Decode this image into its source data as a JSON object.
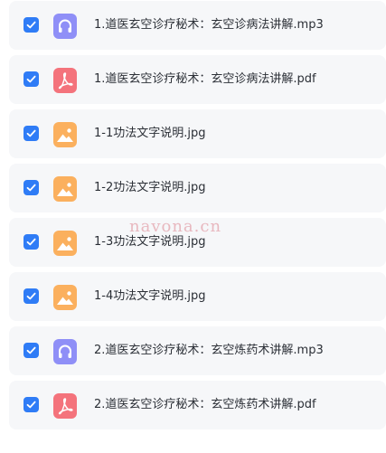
{
  "colors": {
    "checkbox": "#2f7cf6",
    "audio_icon": "#8f8ff7",
    "pdf_icon": "#f4737c",
    "image_icon": "#fbb05e",
    "row_background": "#f6f7f9",
    "watermark": "#e8b8bf"
  },
  "files": [
    {
      "name": "1.道医玄空诊疗秘术：玄空诊病法讲解.mp3",
      "icon": "headphones-icon",
      "checked": true
    },
    {
      "name": "1.道医玄空诊疗秘术：玄空诊病法讲解.pdf",
      "icon": "pdf-icon",
      "checked": true
    },
    {
      "name": "1-1功法文字说明.jpg",
      "icon": "image-icon",
      "checked": true
    },
    {
      "name": "1-2功法文字说明.jpg",
      "icon": "image-icon",
      "checked": true
    },
    {
      "name": "1-3功法文字说明.jpg",
      "icon": "image-icon",
      "checked": true
    },
    {
      "name": "1-4功法文字说明.jpg",
      "icon": "image-icon",
      "checked": true
    },
    {
      "name": "2.道医玄空诊疗秘术：玄空炼药术讲解.mp3",
      "icon": "headphones-icon",
      "checked": true
    },
    {
      "name": "2.道医玄空诊疗秘术：玄空炼药术讲解.pdf",
      "icon": "pdf-icon",
      "checked": true
    }
  ],
  "watermark": "navona.cn"
}
